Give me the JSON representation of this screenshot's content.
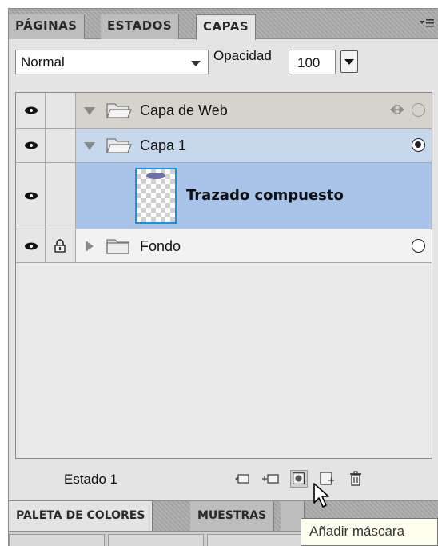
{
  "tabs": {
    "items": [
      {
        "label": "PÁGINAS",
        "active": false
      },
      {
        "label": "ESTADOS",
        "active": false
      },
      {
        "label": "CAPAS",
        "active": true
      }
    ],
    "menu_icon": "panel-menu-icon"
  },
  "controls": {
    "blend_mode": "Normal",
    "opacity_label": "Opacidad",
    "opacity_value": "100"
  },
  "layers": [
    {
      "name": "Capa de Web",
      "type": "folder",
      "expanded": true,
      "visible": true,
      "locked": false,
      "radio": "empty-light"
    },
    {
      "name": "Capa 1",
      "type": "folder",
      "expanded": true,
      "visible": true,
      "locked": false,
      "radio": "selected"
    },
    {
      "name": "Trazado compuesto",
      "type": "object",
      "visible": true,
      "locked": false,
      "selected": true
    },
    {
      "name": "Fondo",
      "type": "folder",
      "expanded": false,
      "visible": true,
      "locked": true,
      "radio": "empty"
    }
  ],
  "status": {
    "state_label": "Estado 1",
    "tools": [
      "share-layer-icon",
      "new-sublayer-icon",
      "add-mask-icon",
      "new-layer-icon",
      "trash-icon"
    ]
  },
  "bottom_tabs": [
    {
      "label": "PALETA DE COLORES",
      "active": true
    },
    {
      "label": "MUESTRAS",
      "active": false
    }
  ],
  "tooltip": "Añadir máscara",
  "colors": {
    "selected_row": "#a8c4e8",
    "active_row": "#c7d8ed",
    "web_row": "#d6d3cc",
    "thumb_border": "#1a8fe0",
    "panel_bg": "#e4e4e4"
  }
}
